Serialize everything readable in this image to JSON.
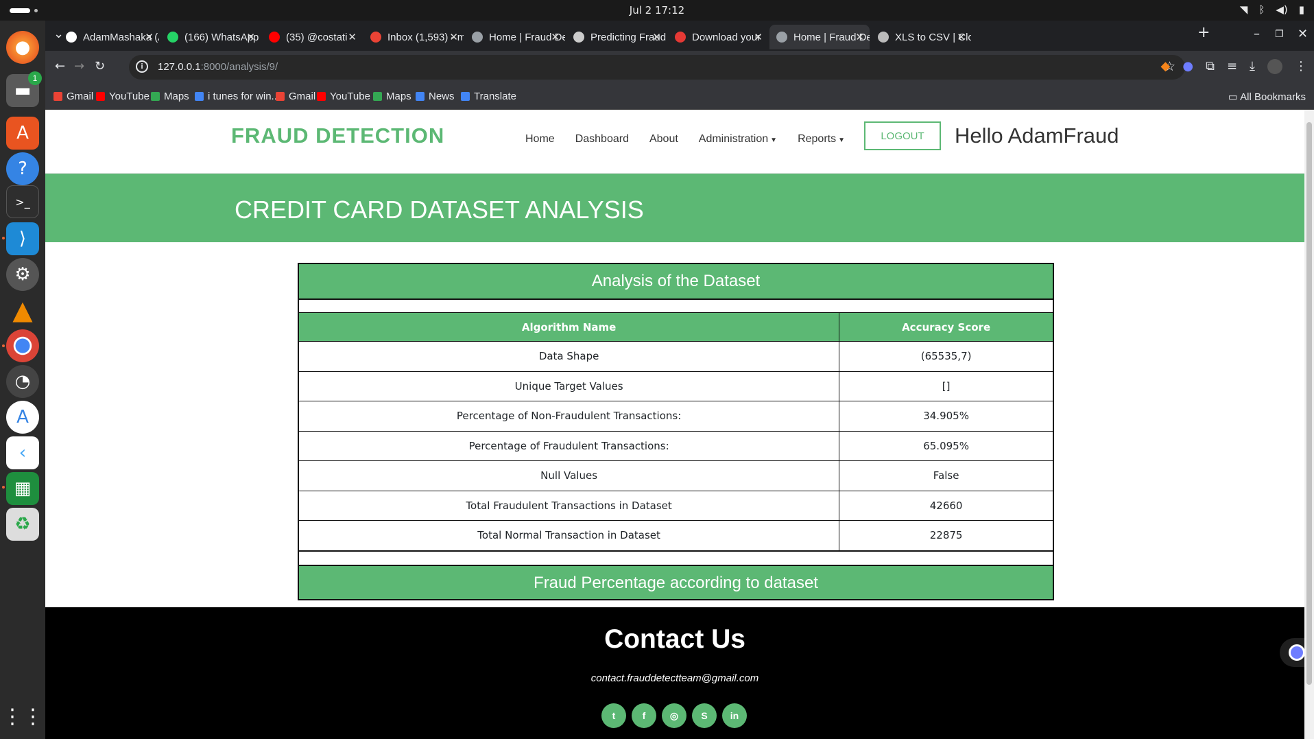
{
  "os": {
    "clock": "Jul 2  17:12",
    "dock_badge": "1"
  },
  "tabs": [
    {
      "title": "AdamMashaka (A",
      "icon": "github-icon",
      "color": "#ffffff"
    },
    {
      "title": "(166) WhatsApp",
      "icon": "whatsapp-icon",
      "color": "#25d366"
    },
    {
      "title": "(35) @costati",
      "icon": "youtube-icon",
      "color": "#ff0000"
    },
    {
      "title": "Inbox (1,593) - m",
      "icon": "gmail-icon",
      "color": "#ea4335"
    },
    {
      "title": "Home | Fraud De",
      "icon": "globe-icon",
      "color": "#9aa0a6"
    },
    {
      "title": "Predicting Fraud",
      "icon": "globe-icon",
      "color": "#cccccc"
    },
    {
      "title": "Download your ",
      "icon": "download-site-icon",
      "color": "#e53935"
    },
    {
      "title": "Home | Fraud De",
      "icon": "globe-icon",
      "color": "#9aa0a6"
    },
    {
      "title": "XLS to CSV | Clo",
      "icon": "cloud-icon",
      "color": "#bbbbbb"
    }
  ],
  "address": {
    "host": "127.0.0.1",
    "path": ":8000/analysis/9/"
  },
  "bookmarks": [
    {
      "label": "Gmail",
      "color": "#ea4335"
    },
    {
      "label": "YouTube",
      "color": "#ff0000"
    },
    {
      "label": "Maps",
      "color": "#34a853"
    },
    {
      "label": "i tunes for win...",
      "color": "#4285f4"
    },
    {
      "label": "Gmail",
      "color": "#ea4335"
    },
    {
      "label": "YouTube",
      "color": "#ff0000"
    },
    {
      "label": "Maps",
      "color": "#34a853"
    },
    {
      "label": "News",
      "color": "#4285f4"
    },
    {
      "label": "Translate",
      "color": "#4285f4"
    }
  ],
  "all_bookmarks": "All Bookmarks",
  "site": {
    "brand": "FRAUD DETECTION",
    "nav": {
      "home": "Home",
      "dashboard": "Dashboard",
      "about": "About",
      "administration": "Administration",
      "reports": "Reports"
    },
    "logout": "LOGOUT",
    "greeting": "Hello AdamFraud",
    "hero_title": "CREDIT CARD DATASET ANALYSIS",
    "accent": "#5cb874"
  },
  "analysis": {
    "title": "Analysis of the Dataset",
    "columns": [
      "Algorithm Name",
      "Accuracy Score"
    ],
    "rows": [
      [
        "Data Shape",
        "(65535,7)"
      ],
      [
        "Unique Target Values",
        "[]"
      ],
      [
        "Percentage of Non-Fraudulent Transactions:",
        "34.905%"
      ],
      [
        "Percentage of Fraudulent Transactions:",
        "65.095%"
      ],
      [
        "Null Values",
        "False"
      ],
      [
        "Total Fraudulent Transactions in Dataset",
        "42660"
      ],
      [
        "Total Normal Transaction in Dataset",
        "22875"
      ]
    ],
    "footer_title": "Fraud Percentage according to dataset"
  },
  "contact": {
    "title": "Contact Us",
    "email": "contact.frauddetectteam@gmail.com",
    "socials": [
      "twitter-icon",
      "facebook-icon",
      "instagram-icon",
      "skype-icon",
      "linkedin-icon"
    ]
  }
}
